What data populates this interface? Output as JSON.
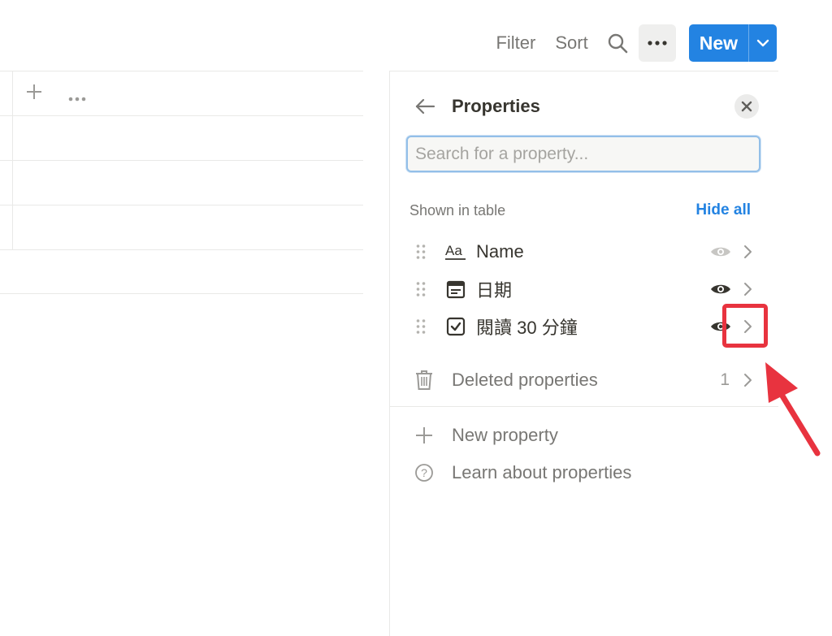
{
  "toolbar": {
    "filter_label": "Filter",
    "sort_label": "Sort",
    "new_label": "New",
    "accent_color": "#2383e2"
  },
  "panel": {
    "title": "Properties",
    "search_placeholder": "Search for a property...",
    "section_title": "Shown in table",
    "hide_all_label": "Hide all",
    "properties": [
      {
        "name": "Name",
        "type_icon": "text-type-icon",
        "visible": false
      },
      {
        "name": "日期",
        "type_icon": "calendar-icon",
        "visible": true
      },
      {
        "name": "閱讀 30 分鐘",
        "type_icon": "checkbox-icon",
        "visible": true
      }
    ],
    "deleted": {
      "label": "Deleted properties",
      "count": "1"
    },
    "new_property_label": "New property",
    "learn_label": "Learn about properties"
  },
  "annotation": {
    "color": "#e8333f"
  }
}
